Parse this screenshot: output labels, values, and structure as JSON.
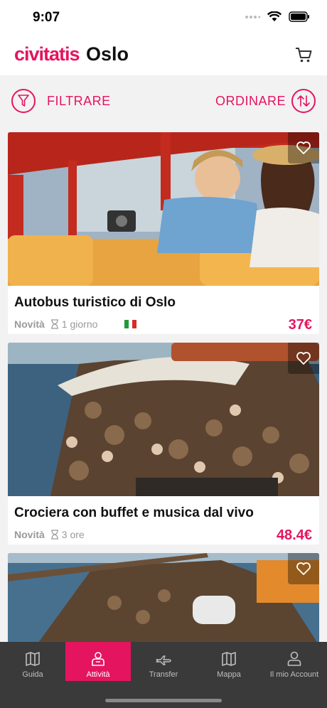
{
  "status": {
    "time": "9:07"
  },
  "header": {
    "brand": "civitatis",
    "city": "Oslo",
    "cart_icon": "cart-icon"
  },
  "toolbar": {
    "filter_label": "FILTRARE",
    "sort_label": "ORDINARE"
  },
  "activities": [
    {
      "title": "Autobus turistico di Oslo",
      "badge": "Novità",
      "duration": "1 giorno",
      "language_flag": "italian-flag-icon",
      "price": "37€"
    },
    {
      "title": "Crociera con buffet e musica dal vivo",
      "badge": "Novità",
      "duration": "3 ore",
      "price": "48.4€"
    },
    {
      "title": "",
      "price": ""
    }
  ],
  "tabs": [
    {
      "label": "Guida",
      "icon": "map-book-icon"
    },
    {
      "label": "Attività",
      "icon": "activities-icon",
      "active": true
    },
    {
      "label": "Transfer",
      "icon": "plane-icon"
    },
    {
      "label": "Mappa",
      "icon": "map-icon"
    },
    {
      "label": "Il mio Account",
      "icon": "user-icon"
    }
  ],
  "colors": {
    "accent": "#e5145f",
    "tabbar": "#3a3a3a",
    "background": "#f2f2f2"
  }
}
